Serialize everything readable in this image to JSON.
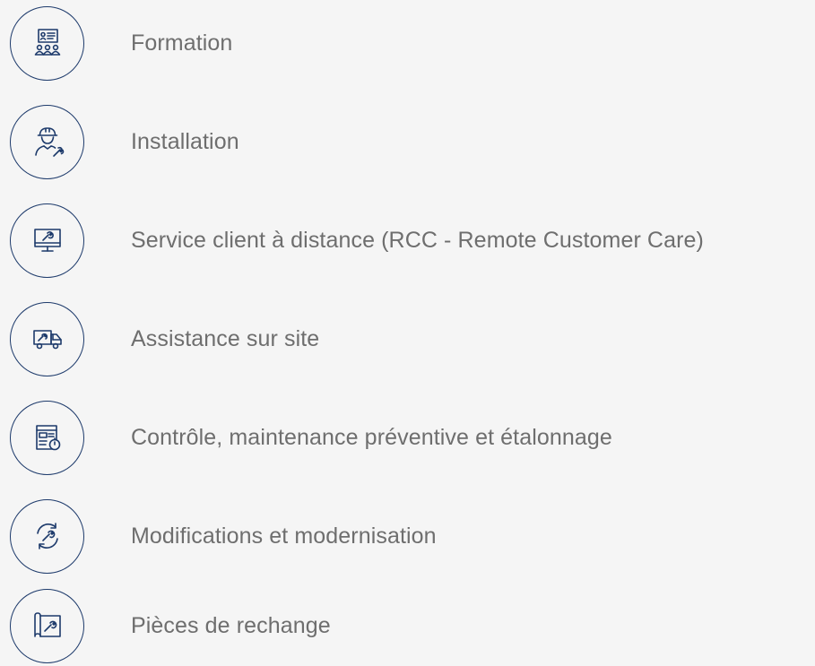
{
  "colors": {
    "background": "#f5f5f5",
    "accent": "#1d3a6b",
    "label": "#6e6e6e"
  },
  "services": [
    {
      "label": "Formation",
      "icon": "training-presentation-icon"
    },
    {
      "label": "Installation",
      "icon": "technician-wrench-icon"
    },
    {
      "label": "Service client à distance (RCC - Remote Customer Care)",
      "icon": "monitor-wrench-icon"
    },
    {
      "label": "Assistance sur site",
      "icon": "service-truck-icon"
    },
    {
      "label": "Contrôle, maintenance préventive et étalonnage",
      "icon": "checklist-timer-icon"
    },
    {
      "label": "Modifications et modernisation",
      "icon": "refresh-wrench-icon"
    },
    {
      "label": "Pièces de rechange",
      "icon": "blueprint-wrench-icon"
    }
  ]
}
